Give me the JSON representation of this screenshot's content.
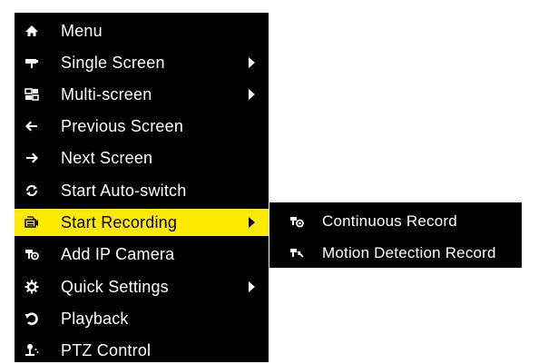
{
  "menu": {
    "items": [
      {
        "label": "Menu",
        "icon": "home-icon",
        "has_submenu": false,
        "active": false
      },
      {
        "label": "Single Screen",
        "icon": "camera-icon",
        "has_submenu": true,
        "active": false
      },
      {
        "label": "Multi-screen",
        "icon": "multiscreen-icon",
        "has_submenu": true,
        "active": false
      },
      {
        "label": "Previous Screen",
        "icon": "arrow-left-icon",
        "has_submenu": false,
        "active": false
      },
      {
        "label": "Next Screen",
        "icon": "arrow-right-icon",
        "has_submenu": false,
        "active": false
      },
      {
        "label": "Start Auto-switch",
        "icon": "refresh-icon",
        "has_submenu": false,
        "active": false
      },
      {
        "label": "Start Recording",
        "icon": "recording-icon",
        "has_submenu": true,
        "active": true
      },
      {
        "label": "Add IP Camera",
        "icon": "ip-camera-icon",
        "has_submenu": false,
        "active": false
      },
      {
        "label": "Quick Settings",
        "icon": "gear-icon",
        "has_submenu": true,
        "active": false
      },
      {
        "label": "Playback",
        "icon": "playback-icon",
        "has_submenu": false,
        "active": false
      },
      {
        "label": "PTZ Control",
        "icon": "ptz-icon",
        "has_submenu": false,
        "active": false
      }
    ]
  },
  "submenu": {
    "items": [
      {
        "label": "Continuous Record",
        "icon": "continuous-record-icon"
      },
      {
        "label": "Motion Detection Record",
        "icon": "motion-record-icon"
      }
    ]
  },
  "colors": {
    "menu_background": "#000000",
    "text": "#ffffff",
    "highlight": "#ffea00",
    "highlight_text": "#000000"
  }
}
